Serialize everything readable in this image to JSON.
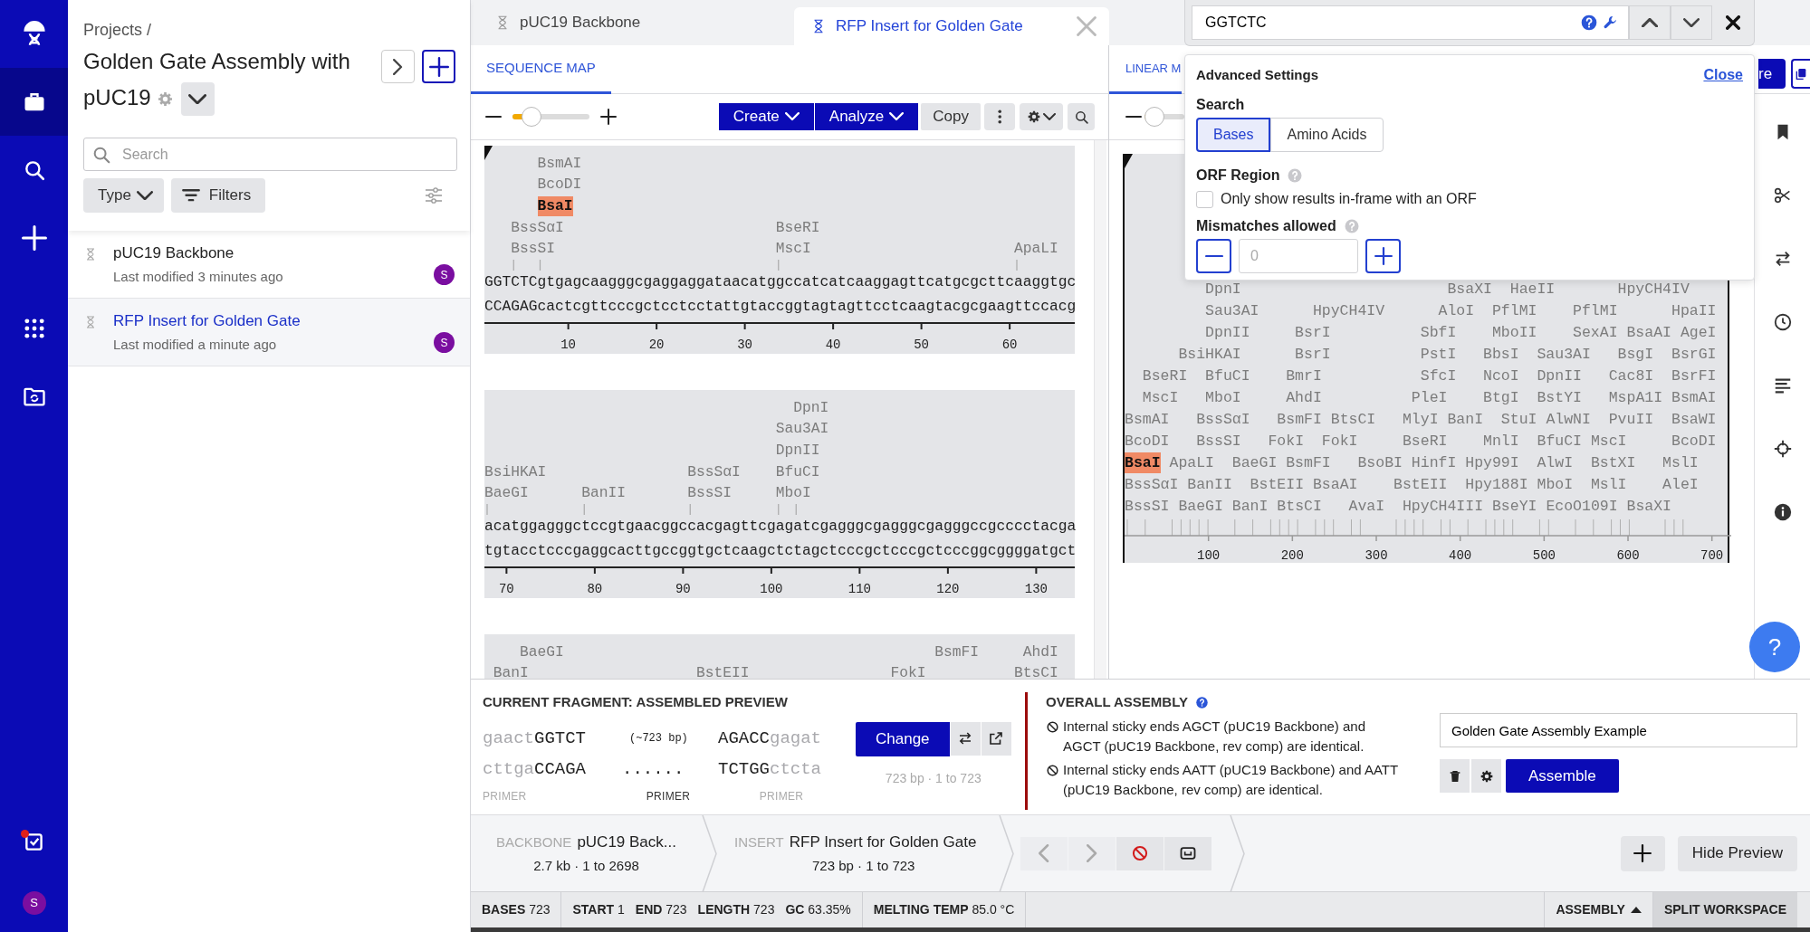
{
  "nav": {
    "items": [
      {
        "kind": "briefcase",
        "selected": true
      },
      {
        "kind": "search",
        "selected": false
      },
      {
        "kind": "plus",
        "selected": false
      },
      {
        "kind": "grid",
        "selected": false
      },
      {
        "kind": "folder",
        "selected": false
      }
    ],
    "tasks": {
      "notification": true
    },
    "avatar": "S"
  },
  "project": {
    "breadcrumb": "Projects /",
    "title_lines": [
      "Golden Gate Assembly with",
      "pUC19"
    ],
    "search_placeholder": "Search",
    "type_filter": "Type",
    "filters": "Filters",
    "files": [
      {
        "name": "pUC19 Backbone",
        "modified": "Last modified 3 minutes ago",
        "avatar": "S",
        "selected": false
      },
      {
        "name": "RFP Insert for Golden Gate",
        "modified": "Last modified a minute ago",
        "avatar": "S",
        "selected": true
      }
    ]
  },
  "tabs": [
    {
      "label": "pUC19 Backbone",
      "selected": false
    },
    {
      "label": "RFP Insert for Golden Gate",
      "selected": true
    }
  ],
  "sequence_map": {
    "view_tab": "SEQUENCE MAP",
    "zoom": {
      "level": 0.25
    },
    "buttons": [
      {
        "label": "Create",
        "kind": "menu"
      },
      {
        "label": "Analyze",
        "kind": "menu"
      },
      {
        "label": "Copy",
        "kind": "plain"
      }
    ],
    "blocks": [
      {
        "origin": true,
        "label_rows": [
          [
            {
              "text": "      BsmAI",
              "hit": false
            }
          ],
          [
            {
              "text": "      BcoDI",
              "hit": false
            }
          ],
          [
            {
              "text": "      BsaI",
              "hit": true
            }
          ],
          [
            {
              "text": "   BssSαI                        BseRI",
              "hit": false
            }
          ],
          [
            {
              "text": "   BssSI                         MscI                       ApaLI",
              "hit": false
            }
          ]
        ],
        "top_strand": "GGTCTCgtgagcaagggcgaggaggataacatggccatcatcaaggagttcatgcgcttcaaggtgc",
        "bottom_strand": "CCAGAGcactcgttcccgctcctcctattgtaccggtagtagttcctcaagtacgcgaagttccacg",
        "ticks": [
          "10",
          "20",
          "30",
          "40",
          "50",
          "60"
        ]
      },
      {
        "origin": false,
        "label_rows": [
          [
            {
              "text": "                                   DpnI",
              "hit": false
            }
          ],
          [
            {
              "text": "                                 Sau3AI",
              "hit": false
            }
          ],
          [
            {
              "text": "                                 DpnII",
              "hit": false
            }
          ],
          [
            {
              "text": "BsiHKAI                BssSαI    BfuCI",
              "hit": false
            }
          ],
          [
            {
              "text": "BaeGI      BanII       BssSI     MboI",
              "hit": false
            }
          ]
        ],
        "top_strand": "acatggagggctccgtgaacggccacgagttcgagatcgagggcgagggcgagggccgcccctacga",
        "bottom_strand": "tgtacctcccgaggcacttgccggtgctcaagctctagctcccgctcccgctcccggcggggatgct",
        "ticks": [
          "70",
          "80",
          "90",
          "100",
          "110",
          "120",
          "130"
        ]
      },
      {
        "origin": false,
        "label_rows": [
          [
            {
              "text": "    BaeGI                                          BsmFI     AhdI",
              "hit": false
            }
          ],
          [
            {
              "text": " BanI                   BstEII                FokI          BtsCI",
              "hit": false
            }
          ]
        ]
      }
    ]
  },
  "linear_map": {
    "view_tab": "LINEAR M",
    "zoom": {
      "level": 0.25
    },
    "share_button": "re",
    "origin": true,
    "label_rows": [
      [
        {
          "text": "         DpnI                       BsaXI  HaeII       HpyCH4IV",
          "hit": false
        }
      ],
      [
        {
          "text": "         Sau3AI      HpyCH4IV      AloI  PflMI    PflMI      HpaII",
          "hit": false
        }
      ],
      [
        {
          "text": "         DpnII     BsrI          SbfI    MboII    SexAI BsaAI AgeI",
          "hit": false
        }
      ],
      [
        {
          "text": "      BsiHKAI      BsrI          PstI   BbsI  Sau3AI   BsgI  BsrGI",
          "hit": false
        }
      ],
      [
        {
          "text": "  BseRI  BfuCI    BmrI           SfcI   NcoI  DpnII   Cac8I  BsrFI",
          "hit": false
        }
      ],
      [
        {
          "text": "  MscI   MboI     AhdI          PleI    BtgI  BstYI   MspA1I BsmAI",
          "hit": false
        }
      ],
      [
        {
          "text": "BsmAI   BssSαI   BsmFI BtsCI   MlyI BanI  StuI AlwNI  PvuII  BsaWI",
          "hit": false
        }
      ],
      [
        {
          "text": "BcoDI   BssSI   FokI  FokI     BseRI    MnlI  BfuCI MscI     BcoDI",
          "hit": false
        }
      ],
      [
        {
          "text": "BsaI",
          "hit": true
        },
        {
          "text": " ApaLI  BaeGI BsmFI   BsoBI HinfI Hpy99I  AlwI  BstXI   MslI",
          "hit": false
        }
      ],
      [
        {
          "text": "BssSαI BanII  BstEII BsaAI    BstEII  Hpy188I MboI  MslI    AleI",
          "hit": false
        }
      ],
      [
        {
          "text": "BssSI BaeGI BanI BtsCI   AvaI  HpyCH4III BseYI EcoO109I BsaXI",
          "hit": false
        }
      ]
    ],
    "axis_labels": [
      "100",
      "200",
      "300",
      "400",
      "500",
      "600",
      "700"
    ]
  },
  "find": {
    "value": "GGTCTC",
    "advanced": {
      "title": "Advanced Settings",
      "close": "Close",
      "search_label": "Search",
      "search_modes": [
        {
          "label": "Bases",
          "selected": true
        },
        {
          "label": "Amino Acids",
          "selected": false
        }
      ],
      "orf_label": "ORF Region",
      "orf_option": {
        "label": "Only show results in-frame with an ORF",
        "checked": false
      },
      "mismatch_label": "Mismatches allowed",
      "mismatch_placeholder": "0"
    }
  },
  "help_fab": "?",
  "assembly": {
    "fragment_title": "CURRENT FRAGMENT: ASSEMBLED PREVIEW",
    "rows": [
      [
        {
          "overhang": "gaact",
          "core": "GGTCT",
          "kind": "left_end"
        },
        {
          "text": "(~723 bp)",
          "kind": "size"
        },
        {
          "core": "AGACC",
          "overhang": "gagat",
          "kind": "right_end"
        }
      ],
      [
        {
          "overhang": "cttga",
          "core": "CCAGA",
          "kind": "left_end"
        },
        {
          "text": "......",
          "kind": "dots"
        },
        {
          "core": "TCTGG",
          "overhang": "ctcta",
          "kind": "right_end"
        }
      ]
    ],
    "primers": [
      {
        "label": "PRIMER",
        "muted": true
      },
      {
        "label": "PRIMER",
        "muted": false
      },
      {
        "label": "PRIMER",
        "muted": true
      }
    ],
    "change_button": "Change",
    "fragment_range": "723 bp · 1 to 723",
    "overall_title": "OVERALL ASSEMBLY",
    "warnings": [
      "Internal sticky ends AGCT (pUC19 Backbone) and AGCT (pUC19 Backbone, rev comp) are identical.",
      "Internal sticky ends AATT (pUC19 Backbone) and AATT (pUC19 Backbone, rev comp) are identical."
    ],
    "name_value": "Golden Gate Assembly Example",
    "assemble_button": "Assemble"
  },
  "fragments": [
    {
      "role": "BACKBONE",
      "name": "pUC19 Back...",
      "detail": "2.7 kb · 1 to 2698"
    },
    {
      "role": "INSERT",
      "name": "RFP Insert for Golden Gate",
      "detail": "723 bp · 1 to 723"
    }
  ],
  "fragment_controls": [
    {
      "kind": "prev",
      "disabled": true
    },
    {
      "kind": "next",
      "disabled": true
    },
    {
      "kind": "remove",
      "disabled": false
    },
    {
      "kind": "gap",
      "disabled": false
    }
  ],
  "hide_preview": "Hide Preview",
  "status": {
    "groups": [
      [
        {
          "label": "BASES",
          "value": "723"
        }
      ],
      [
        {
          "label": "START",
          "value": "1"
        },
        {
          "label": "END",
          "value": "723"
        },
        {
          "label": "LENGTH",
          "value": "723"
        },
        {
          "label": "GC",
          "value": "63.35%"
        }
      ],
      [
        {
          "label": "MELTING TEMP",
          "value": "85.0 °C"
        }
      ]
    ],
    "buttons": [
      {
        "label": "ASSEMBLY",
        "kind": "menu",
        "selected": false
      },
      {
        "label": "SPLIT WORKSPACE",
        "kind": "plain",
        "selected": true
      }
    ]
  }
}
